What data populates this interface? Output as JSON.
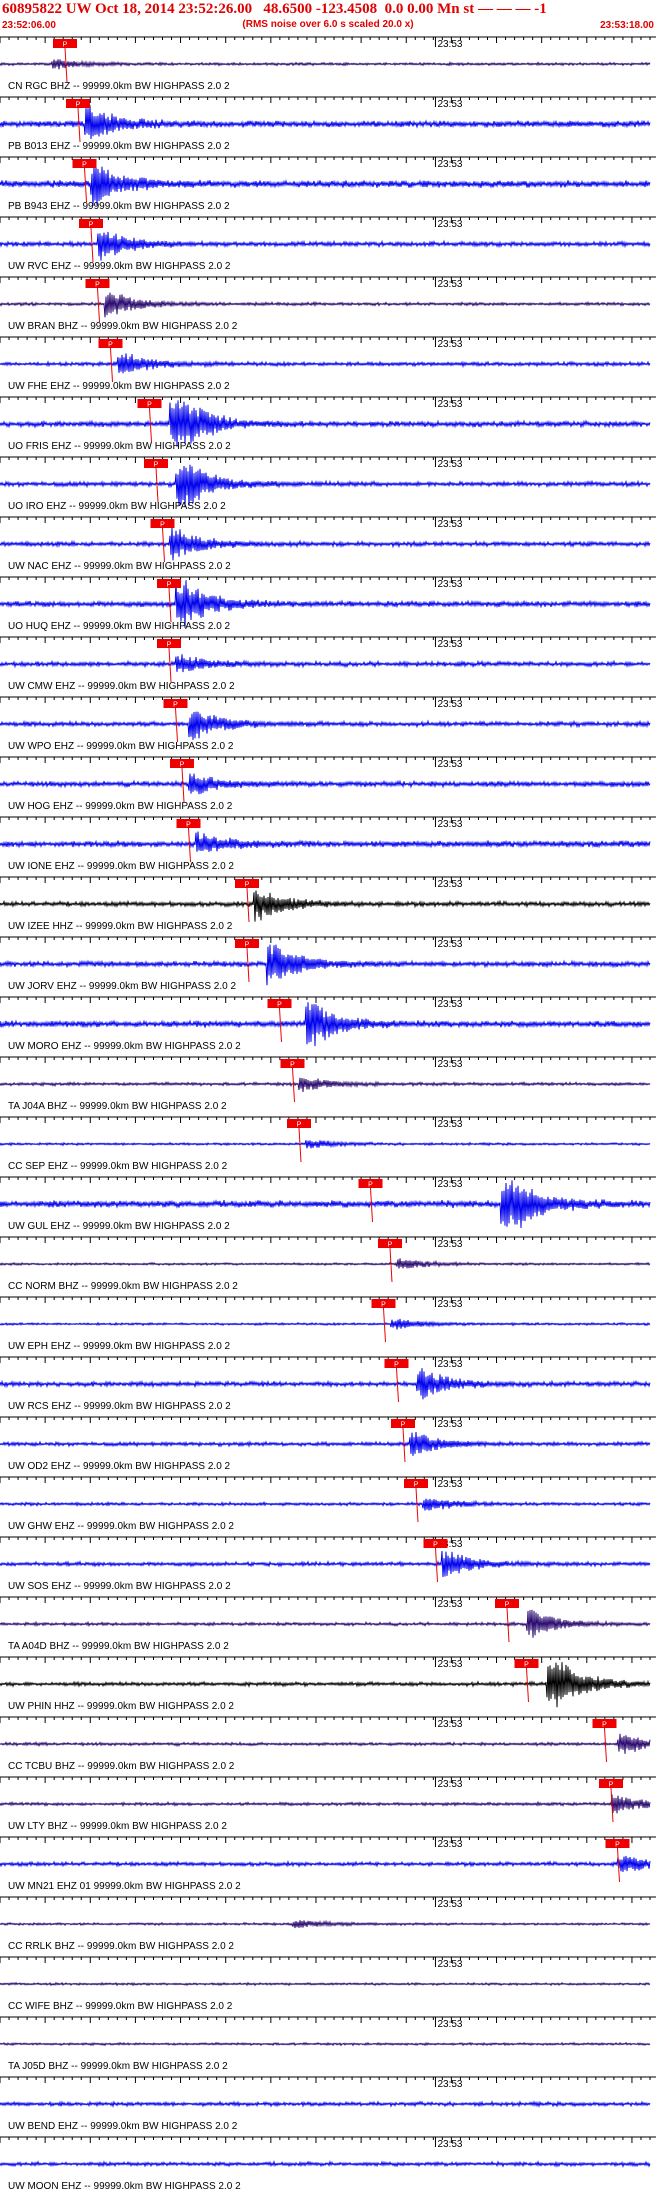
{
  "header": {
    "title": "60895822 UW Oct 18, 2014 23:52:26.00   48.6500 -123.4508  0.0 0.00 Mn st — — — -1",
    "subtitle": "(RMS noise over 6.0 s scaled 20.0 x)",
    "start_time": "23:52:06.00",
    "end_time": "23:53:18.00"
  },
  "minute_mark_label": "23:53",
  "pick_label": "P",
  "colors": {
    "header_text": "#e00000",
    "trace_blue": "#0000ee",
    "trace_purple": "#2a0a70",
    "trace_black": "#000000",
    "pick_red": "#ee0000",
    "axis": "#000000"
  },
  "traces": [
    {
      "label": "CN RGC BHZ -- 99999.0km BW  HIGHPASS  2.0  2",
      "color": "purple",
      "pick": 0.1,
      "amp": 0.35,
      "burst": 0.09,
      "burst_amp": 0.5
    },
    {
      "label": "PB B013 EHZ -- 99999.0km BW  HIGHPASS  2.0  2",
      "color": "blue",
      "pick": 0.12,
      "amp": 0.8,
      "burst": 0.14,
      "burst_amp": 2.2
    },
    {
      "label": "PB B943 EHZ -- 99999.0km BW  HIGHPASS  2.0  2",
      "color": "blue",
      "pick": 0.13,
      "amp": 0.9,
      "burst": 0.15,
      "burst_amp": 2.4
    },
    {
      "label": "UW RVC EHZ -- 99999.0km BW  HIGHPASS  2.0  2",
      "color": "blue",
      "pick": 0.14,
      "amp": 0.6,
      "burst": 0.16,
      "burst_amp": 1.8
    },
    {
      "label": "UW BRAN BHZ -- 99999.0km BW  HIGHPASS  2.0  2",
      "color": "purple",
      "pick": 0.15,
      "amp": 0.4,
      "burst": 0.17,
      "burst_amp": 1.6
    },
    {
      "label": "UW FHE EHZ -- 99999.0km BW  HIGHPASS  2.0  2",
      "color": "blue",
      "pick": 0.17,
      "amp": 0.5,
      "burst": 0.19,
      "burst_amp": 1.5
    },
    {
      "label": "UO FRIS EHZ -- 99999.0km BW  HIGHPASS  2.0  2",
      "color": "blue",
      "pick": 0.23,
      "amp": 0.7,
      "burst": 0.27,
      "burst_amp": 4.5
    },
    {
      "label": "UO IRO EHZ -- 99999.0km BW  HIGHPASS  2.0  2",
      "color": "blue",
      "pick": 0.24,
      "amp": 0.6,
      "burst": 0.28,
      "burst_amp": 3.5
    },
    {
      "label": "UW NAC EHZ -- 99999.0km BW  HIGHPASS  2.0  2",
      "color": "blue",
      "pick": 0.25,
      "amp": 0.6,
      "burst": 0.27,
      "burst_amp": 1.8
    },
    {
      "label": "UO HUQ EHZ -- 99999.0km BW  HIGHPASS  2.0  2",
      "color": "blue",
      "pick": 0.26,
      "amp": 0.7,
      "burst": 0.28,
      "burst_amp": 3.2
    },
    {
      "label": "UW CMW EHZ -- 99999.0km BW  HIGHPASS  2.0  2",
      "color": "blue",
      "pick": 0.26,
      "amp": 0.6,
      "burst": 0.28,
      "burst_amp": 1.0
    },
    {
      "label": "UW WPO EHZ -- 99999.0km BW  HIGHPASS  2.0  2",
      "color": "blue",
      "pick": 0.27,
      "amp": 0.6,
      "burst": 0.3,
      "burst_amp": 1.8
    },
    {
      "label": "UW HOG EHZ -- 99999.0km BW  HIGHPASS  2.0  2",
      "color": "blue",
      "pick": 0.28,
      "amp": 0.7,
      "burst": 0.3,
      "burst_amp": 1.2
    },
    {
      "label": "UW IONE EHZ -- 99999.0km BW  HIGHPASS  2.0  2",
      "color": "blue",
      "pick": 0.29,
      "amp": 0.8,
      "burst": 0.31,
      "burst_amp": 1.2
    },
    {
      "label": "UW IZEE HHZ -- 99999.0km BW  HIGHPASS  2.0  2",
      "color": "black",
      "pick": 0.38,
      "amp": 0.6,
      "burst": 0.4,
      "burst_amp": 2.0
    },
    {
      "label": "UW JORV EHZ -- 99999.0km BW  HIGHPASS  2.0  2",
      "color": "blue",
      "pick": 0.38,
      "amp": 0.7,
      "burst": 0.42,
      "burst_amp": 2.5
    },
    {
      "label": "UW MORO EHZ -- 99999.0km BW  HIGHPASS  2.0  2",
      "color": "blue",
      "pick": 0.43,
      "amp": 0.8,
      "burst": 0.48,
      "burst_amp": 2.8
    },
    {
      "label": "TA J04A BHZ -- 99999.0km BW  HIGHPASS  2.0  2",
      "color": "purple",
      "pick": 0.45,
      "amp": 0.4,
      "burst": 0.47,
      "burst_amp": 0.8
    },
    {
      "label": "CC SEP EHZ -- 99999.0km BW  HIGHPASS  2.0  2",
      "color": "blue",
      "pick": 0.46,
      "amp": 0.3,
      "burst": 0.48,
      "burst_amp": 0.5
    },
    {
      "label": "UW GUL EHZ -- 99999.0km BW  HIGHPASS  2.0  2",
      "color": "blue",
      "pick": 0.57,
      "amp": 0.9,
      "burst": 0.78,
      "burst_amp": 4.5
    },
    {
      "label": "CC NORM BHZ -- 99999.0km BW  HIGHPASS  2.0  2",
      "color": "purple",
      "pick": 0.6,
      "amp": 0.3,
      "burst": 0.62,
      "burst_amp": 0.6
    },
    {
      "label": "UW EPH EHZ -- 99999.0km BW  HIGHPASS  2.0  2",
      "color": "blue",
      "pick": 0.59,
      "amp": 0.3,
      "burst": 0.61,
      "burst_amp": 0.6
    },
    {
      "label": "UW RCS EHZ -- 99999.0km BW  HIGHPASS  2.0  2",
      "color": "blue",
      "pick": 0.61,
      "amp": 0.6,
      "burst": 0.65,
      "burst_amp": 1.8
    },
    {
      "label": "UW OD2 EHZ -- 99999.0km BW  HIGHPASS  2.0  2",
      "color": "blue",
      "pick": 0.62,
      "amp": 0.5,
      "burst": 0.64,
      "burst_amp": 1.4
    },
    {
      "label": "UW GHW EHZ -- 99999.0km BW  HIGHPASS  2.0  2",
      "color": "blue",
      "pick": 0.64,
      "amp": 0.4,
      "burst": 0.66,
      "burst_amp": 0.8
    },
    {
      "label": "UW SOS EHZ -- 99999.0km BW  HIGHPASS  2.0  2",
      "color": "blue",
      "pick": 0.67,
      "amp": 0.5,
      "burst": 0.69,
      "burst_amp": 1.5
    },
    {
      "label": "TA A04D BHZ -- 99999.0km BW  HIGHPASS  2.0  2",
      "color": "purple",
      "pick": 0.78,
      "amp": 0.4,
      "burst": 0.82,
      "burst_amp": 1.6
    },
    {
      "label": "UW PHIN HHZ -- 99999.0km BW  HIGHPASS  2.0  2",
      "color": "black",
      "pick": 0.81,
      "amp": 0.5,
      "burst": 0.85,
      "burst_amp": 4.0
    },
    {
      "label": "CC TCBU BHZ -- 99999.0km BW  HIGHPASS  2.0  2",
      "color": "purple",
      "pick": 0.93,
      "amp": 0.4,
      "burst": 0.96,
      "burst_amp": 1.2
    },
    {
      "label": "UW LTY BHZ -- 99999.0km BW  HIGHPASS  2.0  2",
      "color": "purple",
      "pick": 0.94,
      "amp": 0.4,
      "burst": 0.95,
      "burst_amp": 1.0
    },
    {
      "label": "UW MN21 EHZ 01 99999.0km BW  HIGHPASS  2.0  2",
      "color": "blue",
      "pick": 0.95,
      "amp": 0.5,
      "burst": 0.96,
      "burst_amp": 1.0
    },
    {
      "label": "CC RRLK BHZ -- 99999.0km BW  HIGHPASS  2.0  2",
      "color": "purple",
      "pick": null,
      "amp": 0.3,
      "burst": 0.46,
      "burst_amp": 0.5
    },
    {
      "label": "CC WIFE BHZ -- 99999.0km BW  HIGHPASS  2.0  2",
      "color": "purple",
      "pick": null,
      "amp": 0.3,
      "burst": null,
      "burst_amp": 0
    },
    {
      "label": "TA J05D BHZ -- 99999.0km BW  HIGHPASS  2.0  2",
      "color": "purple",
      "pick": null,
      "amp": 0.3,
      "burst": null,
      "burst_amp": 0
    },
    {
      "label": "UW BEND EHZ -- 99999.0km BW  HIGHPASS  2.0  2",
      "color": "blue",
      "pick": null,
      "amp": 0.5,
      "burst": null,
      "burst_amp": 0
    },
    {
      "label": "UW MOON EHZ -- 99999.0km BW  HIGHPASS  2.0  2",
      "color": "blue",
      "pick": null,
      "amp": 0.5,
      "burst": null,
      "burst_amp": 0
    }
  ]
}
